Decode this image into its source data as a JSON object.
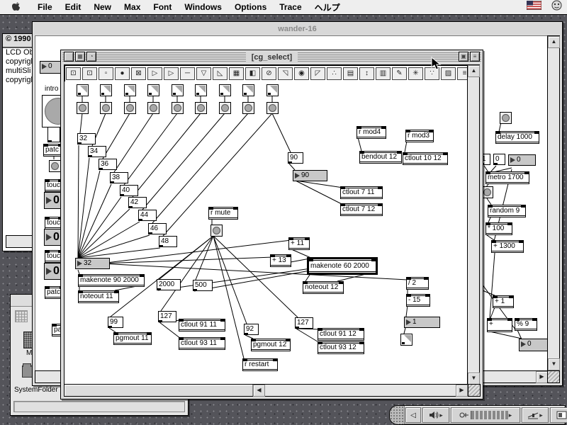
{
  "menu_bar": {
    "items": [
      "File",
      "Edit",
      "New",
      "Max",
      "Font",
      "Windows",
      "Options",
      "Trace",
      "ヘルプ"
    ]
  },
  "palette": {
    "icons": [
      "⊡",
      "⊡",
      "▫",
      "●",
      "⊠",
      "▷",
      "▷",
      "─",
      "▽",
      "◺",
      "▦",
      "◧",
      "⊘",
      "◹",
      "◉",
      "◸",
      "∴",
      "▤",
      "↕",
      "▥",
      "✎",
      "✳",
      "∵",
      "▨",
      "≡",
      "▧"
    ]
  },
  "patcher": {
    "title": "[cg_select]",
    "stair": [
      "32",
      "34",
      "36",
      "38",
      "40",
      "42",
      "44",
      "46",
      "48"
    ],
    "boxes": {
      "num32": "32",
      "makenote1": "makenote 90 2000",
      "noteout1": "noteout 11",
      "msg2000": "2000",
      "msg500": "500",
      "msg99": "99",
      "pgmout1": "pgmout 11",
      "msg127a": "127",
      "ctl9111": "ctlout 91 11",
      "ctl9311": "ctlout 93 11",
      "msg92": "92",
      "pgmout2": "pgmout 12",
      "rrestart": "r restart",
      "msg127b": "127",
      "ctl9112": "ctlout 91 12",
      "ctl9312": "ctlout 93 12",
      "rmute": "r mute",
      "plus11": "+ 11",
      "plus13": "+ 13",
      "makenote2": "makenote 60 2000",
      "noteout2": "noteout 12",
      "msg90": "90",
      "num90": "90",
      "rmod4": "r mod4",
      "bendout": "bendout 12",
      "rmod3": "r mod3",
      "ctl1012": "ctlout 10 12",
      "ctl711": "ctlout 7 11",
      "ctl712": "ctlout 7 12",
      "div2": "/ 2",
      "minus15": "- 15",
      "num1": "1"
    }
  },
  "wander": {
    "title": "wander-16",
    "left": {
      "num0": "0",
      "comment": "intro",
      "patch1": "patc",
      "touch1": "touc",
      "big1": "0",
      "touch2": "touc",
      "big2": "0",
      "touch3": "touc",
      "big3": "0",
      "patch2": "patc",
      "patch3": "pa"
    },
    "right": {
      "delay": "delay 1000",
      "msg1": "1",
      "msg0": "0",
      "num0a": "0",
      "metro": "metro 1700",
      "random": "random 9",
      "times100": "* 100",
      "plus1300": "+ 1300",
      "plus1": "+ 1",
      "plus": "+",
      "mod9": "% 9",
      "num0b": "0"
    }
  },
  "lcd": {
    "title": "© 1990",
    "lines": [
      "LCD Obj",
      "copyrigh",
      "multiSli",
      "copyrigh"
    ]
  },
  "finder": {
    "label": "SystemFolder",
    "icon1_label": "M"
  }
}
